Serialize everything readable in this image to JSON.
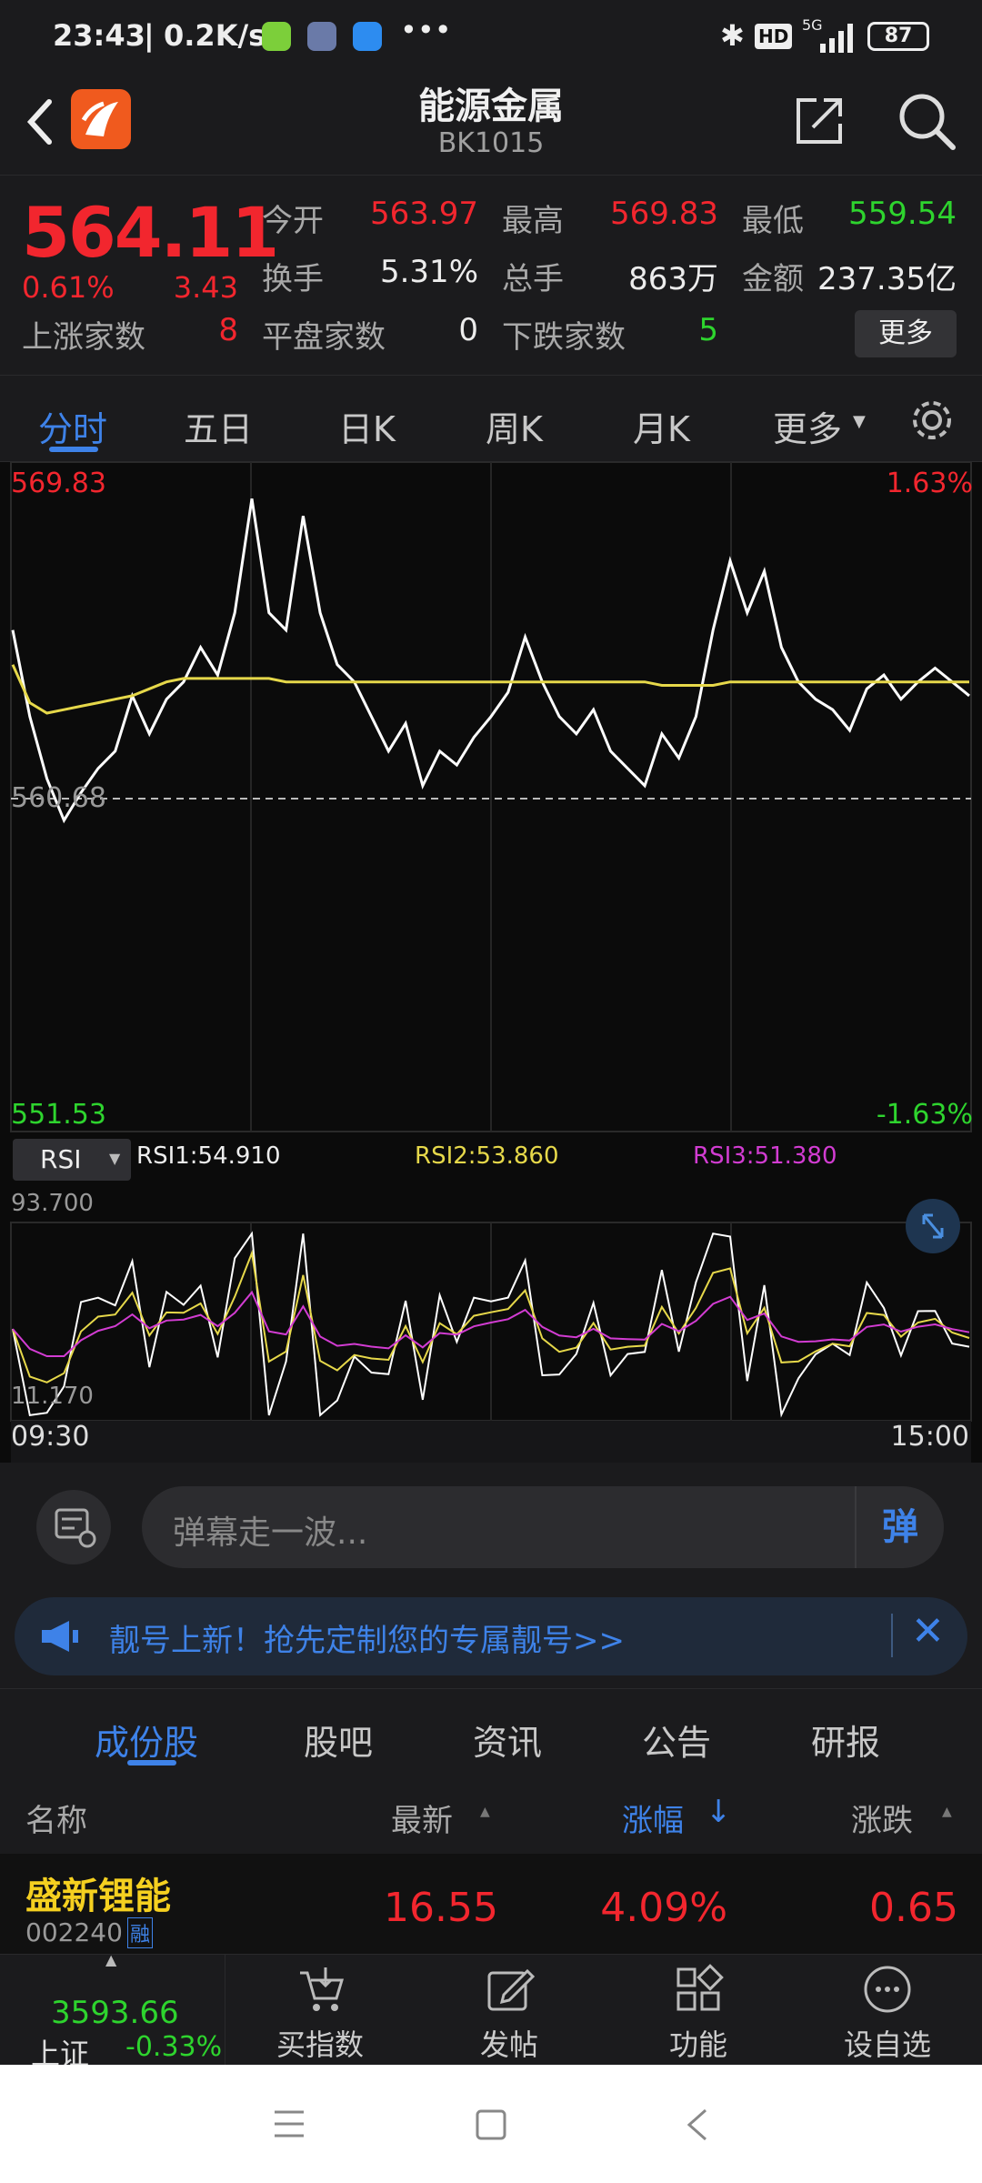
{
  "status_bar": {
    "time": "23:43",
    "net_speed": "0.2K/s",
    "battery": "87",
    "signal": "5G"
  },
  "header": {
    "title": "能源金属",
    "code": "BK1015"
  },
  "quote": {
    "price": "564.11",
    "change_pct": "0.61%",
    "change": "3.43",
    "open_label": "今开",
    "open": "563.97",
    "high_label": "最高",
    "high": "569.83",
    "low_label": "最低",
    "low": "559.54",
    "turnover_label": "换手",
    "turnover": "5.31%",
    "volume_label": "总手",
    "volume": "863万",
    "amount_label": "金额",
    "amount": "237.35亿",
    "up_label": "上涨家数",
    "up": "8",
    "flat_label": "平盘家数",
    "flat": "0",
    "down_label": "下跌家数",
    "down": "5",
    "more_button": "更多"
  },
  "chart_tabs": [
    "分时",
    "五日",
    "日K",
    "周K",
    "月K",
    "更多"
  ],
  "chart": {
    "y_high": "569.83",
    "y_mid": "560.68",
    "y_low": "551.53",
    "pct_high": "1.63%",
    "pct_low": "-1.63%",
    "indicator": "RSI",
    "rsi1": "RSI1:54.910",
    "rsi2": "RSI2:53.860",
    "rsi3": "RSI3:51.380",
    "rsi_max": "93.700",
    "rsi_min": "11.170",
    "time_start": "09:30",
    "time_end": "15:00"
  },
  "chart_data": {
    "type": "line",
    "series": [
      {
        "name": "price",
        "values": [
          565.5,
          563.0,
          561.2,
          560.0,
          560.8,
          561.5,
          562.0,
          563.6,
          562.5,
          563.5,
          564.0,
          565.0,
          564.2,
          566.0,
          569.3,
          566.0,
          565.5,
          568.8,
          566.0,
          564.5,
          564.0,
          563.0,
          562.0,
          562.8,
          561.0,
          562.0,
          561.6,
          562.4,
          563.0,
          563.7,
          565.3,
          564.0,
          563.0,
          562.5,
          563.2,
          562.0,
          561.5,
          561.0,
          562.5,
          561.8,
          563.0,
          565.5,
          567.5,
          566.0,
          567.2,
          565.0,
          564.0,
          563.5,
          563.2,
          562.6,
          563.8,
          564.2,
          563.5,
          564.0,
          564.4,
          564.0,
          563.6
        ]
      },
      {
        "name": "average",
        "values": [
          564.5,
          563.4,
          563.1,
          563.2,
          563.3,
          563.4,
          563.5,
          563.6,
          563.8,
          564.0,
          564.1,
          564.1,
          564.1,
          564.1,
          564.1,
          564.1,
          564.0,
          564.0,
          564.0,
          564.0,
          564.0,
          564.0,
          564.0,
          564.0,
          564.0,
          564.0,
          564.0,
          564.0,
          564.0,
          564.0,
          564.0,
          564.0,
          564.0,
          564.0,
          564.0,
          564.0,
          564.0,
          564.0,
          563.9,
          563.9,
          563.9,
          563.9,
          564.0,
          564.0,
          564.0,
          564.0,
          564.0,
          564.0,
          564.0,
          564.0,
          564.0,
          564.0,
          564.0,
          564.0,
          564.0,
          564.0,
          564.0
        ]
      }
    ],
    "ylim": [
      551.53,
      569.83
    ]
  },
  "danmu": {
    "placeholder": "弹幕走一波...",
    "send": "弹"
  },
  "banner": {
    "text": "靓号上新！抢先定制您的专属靓号>>"
  },
  "sub_tabs": [
    "成份股",
    "股吧",
    "资讯",
    "公告",
    "研报"
  ],
  "list_head": {
    "name": "名称",
    "latest": "最新",
    "pct": "涨幅",
    "pct_arrow": "↓",
    "change": "涨跌"
  },
  "stocks": [
    {
      "name": "盛新锂能",
      "code": "002240",
      "tag": "融",
      "latest": "16.55",
      "pct": "4.09%",
      "change": "0.65"
    }
  ],
  "bottom_bar": {
    "index_value": "3593.66",
    "index_name": "上证",
    "index_change": "-0.33%",
    "items": [
      "买指数",
      "发帖",
      "功能",
      "设自选"
    ]
  },
  "colors": {
    "up": "#f2262e",
    "down": "#2ed42e",
    "accent": "#3e82e8",
    "avg_line": "#e6d84a",
    "rsi3": "#d23cd2"
  }
}
